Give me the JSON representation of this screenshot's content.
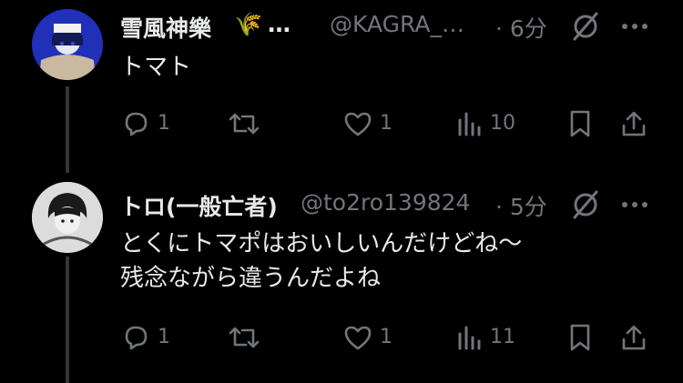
{
  "posts": [
    {
      "display_name": "雪風神樂",
      "name_emoji": "🌾",
      "ellipsis": "…",
      "handle": "@KAGRA_…",
      "time": "· 6分",
      "text_lines": [
        "トマト"
      ],
      "actions": {
        "reply": "1",
        "repost": "",
        "like": "1",
        "views": "10"
      }
    },
    {
      "display_name": "トロ(一般亡者)",
      "handle": "@to2ro139824",
      "time": "· 5分",
      "text_lines": [
        "とくにトマポはおいしいんだけどね〜",
        "残念ながら違うんだよね"
      ],
      "actions": {
        "reply": "1",
        "repost": "",
        "like": "1",
        "views": "11"
      }
    }
  ]
}
